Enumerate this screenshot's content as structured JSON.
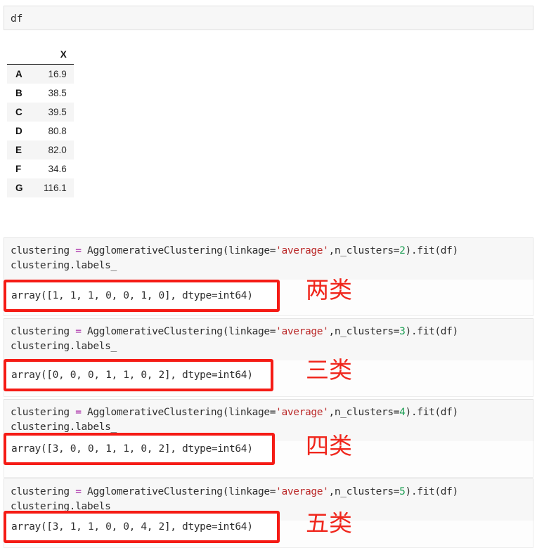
{
  "notebook": {
    "first_cell": {
      "code": "df"
    },
    "dataframe": {
      "columns": [
        "X"
      ],
      "index": [
        "A",
        "B",
        "C",
        "D",
        "E",
        "F",
        "G"
      ],
      "values": [
        "16.9",
        "38.5",
        "39.5",
        "80.8",
        "82.0",
        "34.6",
        "116.1"
      ]
    },
    "cells": [
      {
        "code_prefix": "clustering = AgglomerativeClustering(linkage=",
        "code_eq": "=",
        "code_name": "clustering ",
        "code_call": " AgglomerativeClustering(linkage=",
        "string_arg": "'average'",
        "mid": ",n_clusters=",
        "n_clusters": "2",
        "suffix": ").fit(df)",
        "line2": "clustering.labels_",
        "output": "array([1, 1, 1, 0, 0, 1, 0], dtype=int64)",
        "annotation": "两类"
      },
      {
        "code_name": "clustering ",
        "code_eq": "=",
        "code_call": " AgglomerativeClustering(linkage=",
        "string_arg": "'average'",
        "mid": ",n_clusters=",
        "n_clusters": "3",
        "suffix": ").fit(df)",
        "line2": "clustering.labels_",
        "output": "array([0, 0, 0, 1, 1, 0, 2], dtype=int64)",
        "annotation": "三类"
      },
      {
        "code_name": "clustering ",
        "code_eq": "=",
        "code_call": " AgglomerativeClustering(linkage=",
        "string_arg": "'average'",
        "mid": ",n_clusters=",
        "n_clusters": "4",
        "suffix": ").fit(df)",
        "line2": "clustering.labels_",
        "output": "array([3, 0, 0, 1, 1, 0, 2], dtype=int64)",
        "annotation": "四类"
      },
      {
        "code_name": "clustering ",
        "code_eq": "=",
        "code_call": " AgglomerativeClustering(linkage=",
        "string_arg": "'average'",
        "mid": ",n_clusters=",
        "n_clusters": "5",
        "suffix": ").fit(df)",
        "line2": "clustering.labels_",
        "output": "array([3, 1, 1, 0, 0, 4, 2], dtype=int64)",
        "annotation": "五类"
      }
    ]
  },
  "colors": {
    "highlight_box": "#f51b15",
    "annotation": "#f0261c",
    "string_token": "#bb2a2a",
    "number_token": "#1a9e52",
    "operator_token": "#a626a4",
    "cell_background": "#f7f7f7"
  }
}
